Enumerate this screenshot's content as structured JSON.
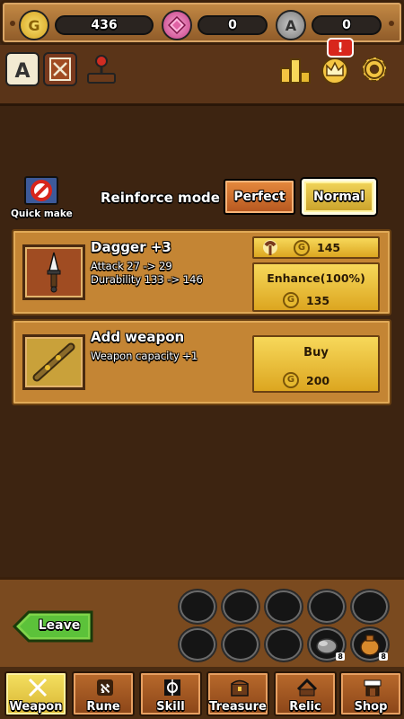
{
  "currencies": {
    "gold": {
      "value": "436",
      "icon": "gold-coin-icon",
      "glyph": "G"
    },
    "gem": {
      "value": "0",
      "icon": "pink-gem-icon"
    },
    "ore": {
      "value": "0",
      "icon": "ore-a-icon",
      "glyph": "A"
    }
  },
  "top_icons": {
    "notice_badge": "!"
  },
  "quick_make": {
    "label": "Quick make"
  },
  "reinforce": {
    "label": "Reinforce mode",
    "perfect": "Perfect",
    "normal": "Normal",
    "selected": "Normal"
  },
  "items": [
    {
      "title": "Dagger +3",
      "line1": "Attack 27 -> 29",
      "line2": "Durability 133 -> 146",
      "repair_cost": "145",
      "action_label": "Enhance(100%)",
      "action_cost": "135"
    },
    {
      "title": "Add weapon",
      "line1": "Weapon capacity +1",
      "action_label": "Buy",
      "action_cost": "200"
    }
  ],
  "leave": {
    "label": "Leave"
  },
  "slot_badge": "8",
  "tabs": [
    {
      "label": "Weapon",
      "active": true
    },
    {
      "label": "Rune",
      "active": false
    },
    {
      "label": "Skill",
      "active": false
    },
    {
      "label": "Treasure",
      "active": false
    },
    {
      "label": "Relic",
      "active": false
    },
    {
      "label": "Shop",
      "active": false
    }
  ],
  "colors": {
    "panel": "#c48534",
    "gold": "#e6b92f",
    "active_tab": "#f4e061",
    "leave_green": "#5cc23a"
  }
}
